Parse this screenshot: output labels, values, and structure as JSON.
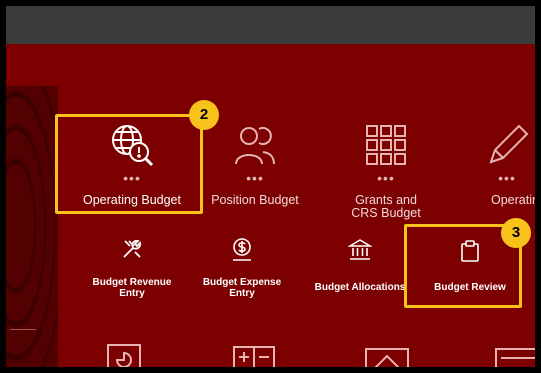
{
  "tiles_row1": [
    {
      "label": "Operating Budget",
      "icon": "globe-alert-icon"
    },
    {
      "label": "Position Budget",
      "icon": "people-icon"
    },
    {
      "label": "Grants and CRS Budget",
      "icon": "grid-icon"
    },
    {
      "label": "Operating F",
      "icon": "pencil-icon"
    }
  ],
  "tiles_row2": [
    {
      "label": "Budget Revenue Entry",
      "icon": "tools-icon"
    },
    {
      "label": "Budget Expense Entry",
      "icon": "dollar-icon"
    },
    {
      "label": "Budget Allocations",
      "icon": "bank-icon"
    },
    {
      "label": "Budget Review",
      "icon": "clipboard-icon"
    }
  ],
  "callouts": {
    "step2": "2",
    "step3": "3"
  },
  "colors": {
    "background": "#7d0000",
    "topbar": "#3b3b3b",
    "highlight": "#f7c21a"
  }
}
